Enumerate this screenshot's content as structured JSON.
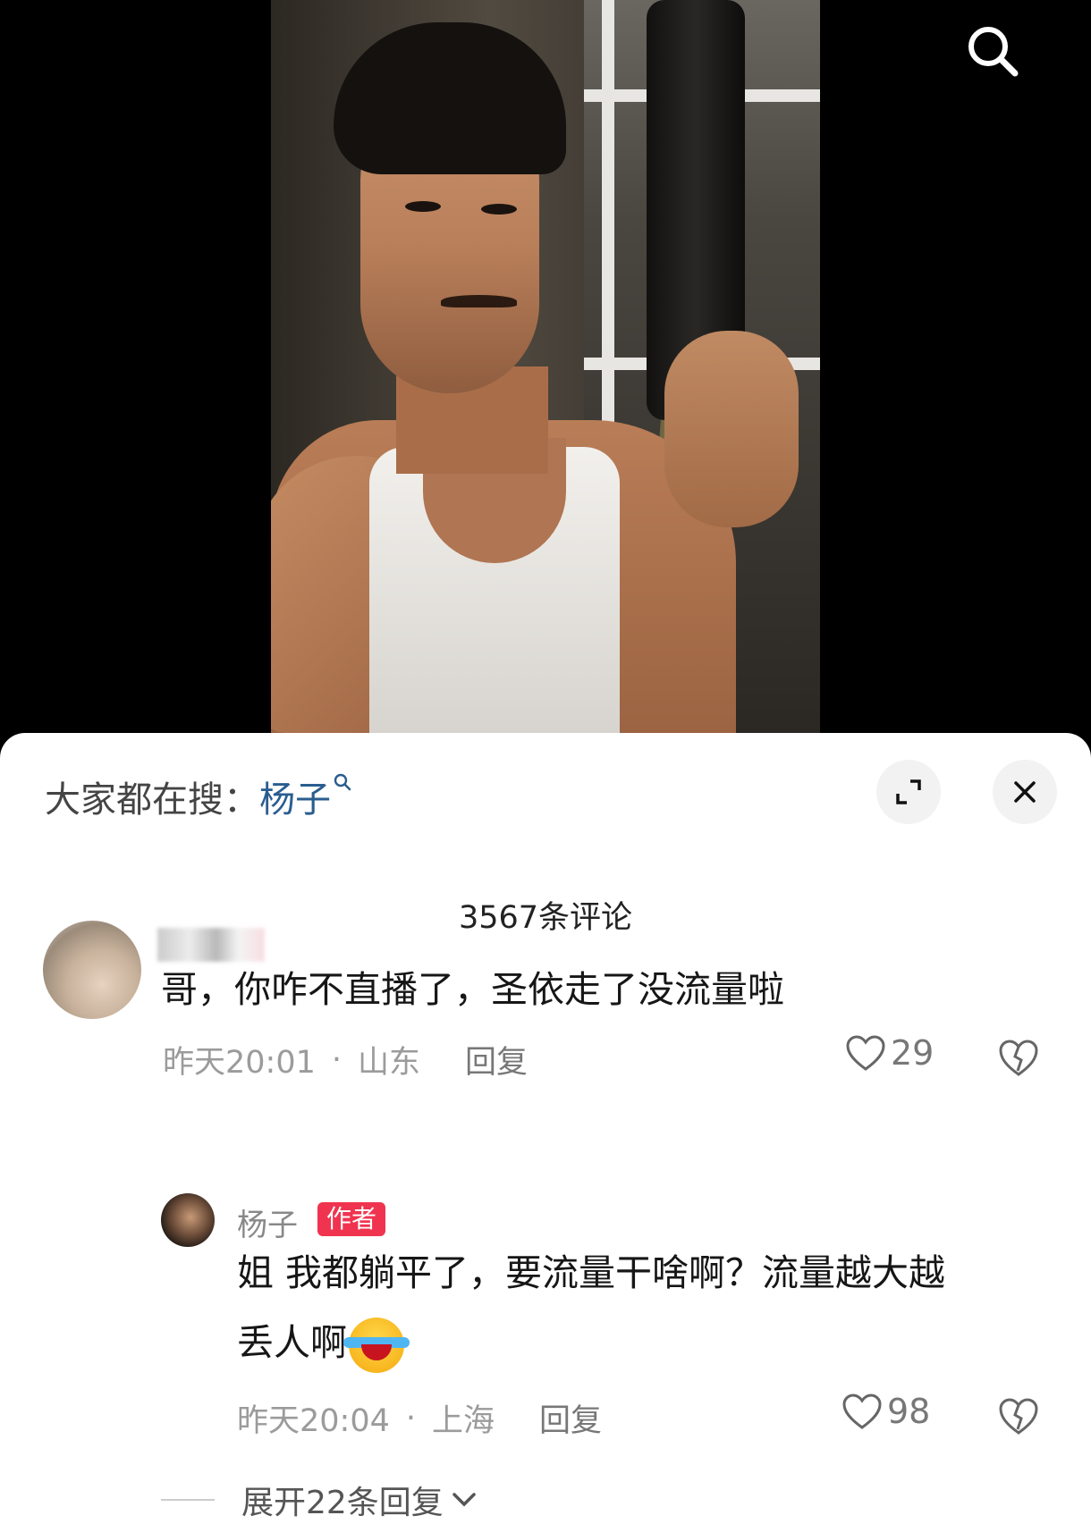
{
  "media": {
    "search_icon": "search-icon"
  },
  "sheet": {
    "hot_search_prefix": "大家都在搜：",
    "hot_search_keyword": "杨子",
    "expand_icon": "expand-icon",
    "close_icon": "close-icon",
    "comment_count": "3567条评论"
  },
  "comments": [
    {
      "text": "哥，你咋不直播了，圣依走了没流量啦",
      "time": "昨天20:01",
      "location": "山东",
      "reply_label": "回复",
      "likes": "29"
    }
  ],
  "reply": {
    "username": "杨子",
    "badge": "作者",
    "text_line1": "姐 我都躺平了，要流量干啥啊？流量越大越",
    "text_line2": "丢人啊",
    "emoji": "laughing-crying-emoji",
    "time": "昨天20:04",
    "location": "上海",
    "reply_label": "回复",
    "likes": "98"
  },
  "expand_replies_label": "展开22条回复",
  "colors": {
    "badge": "#f0344f",
    "keyword": "#2a5d8f"
  }
}
